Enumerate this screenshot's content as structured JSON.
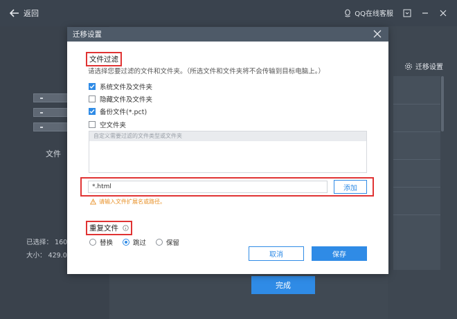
{
  "topbar": {
    "back_label": "返回",
    "qq_label": "QQ在线客服"
  },
  "left": {
    "file_label": "文件",
    "selected_label": "已选择：",
    "selected_value": "160",
    "size_label": "大小：",
    "size_value": "429.0"
  },
  "right": {
    "migrate_settings_label": "迁移设置"
  },
  "done_label": "完成",
  "dialog": {
    "title": "迁移设置",
    "file_filter_title": "文件过滤",
    "file_filter_desc": "请选择您要过滤的文件和文件夹。（所选文件和文件夹将不会传输到目标电脑上。）",
    "options": [
      {
        "label": "系统文件及文件夹",
        "checked": true
      },
      {
        "label": "隐藏文件及文件夹",
        "checked": false
      },
      {
        "label": "备份文件(*.pct)",
        "checked": true
      },
      {
        "label": "空文件夹",
        "checked": false
      }
    ],
    "custom_box_header": "自定义需要过滤的文件类型或文件夹",
    "ext_input_value": "*.html",
    "add_label": "添加",
    "hint": "请输入文件扩展名或路径。",
    "duplicate_title": "重复文件",
    "radios": [
      {
        "label": "替换",
        "selected": false
      },
      {
        "label": "跳过",
        "selected": true
      },
      {
        "label": "保留",
        "selected": false
      }
    ],
    "cancel_label": "取消",
    "save_label": "保存"
  },
  "colors": {
    "accent": "#2f8be6",
    "highlight_border": "#e03333",
    "warning": "#e8922a",
    "dialog_header": "#4e5a68"
  }
}
